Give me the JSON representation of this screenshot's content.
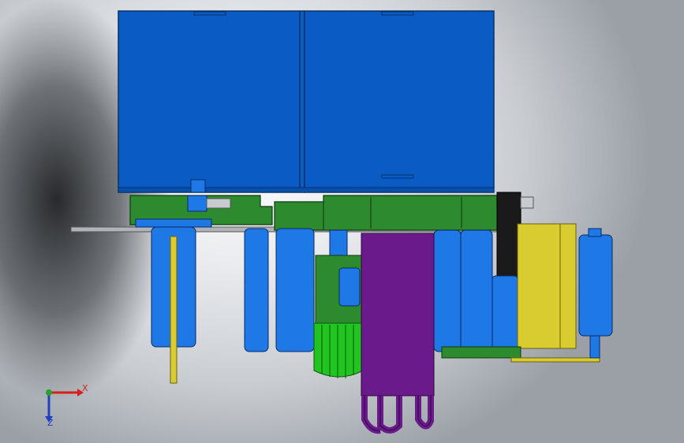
{
  "window": {
    "title": ""
  },
  "triad": {
    "x_label": "X",
    "y_label": "Y",
    "z_label": "Z",
    "x_color": "#d42020",
    "y_color": "#2ca02c",
    "z_color": "#2040c0"
  },
  "model": {
    "colors": {
      "housing_blue": "#0a5cc4",
      "roller_blue": "#1e78e6",
      "frame_green": "#2e8a2e",
      "cylinder_purple": "#6a1a8a",
      "panel_yellow": "#d8cc30",
      "motor_green": "#22c422",
      "black_block": "#1a1a1a",
      "plate_gray": "#9a9ea4"
    }
  }
}
